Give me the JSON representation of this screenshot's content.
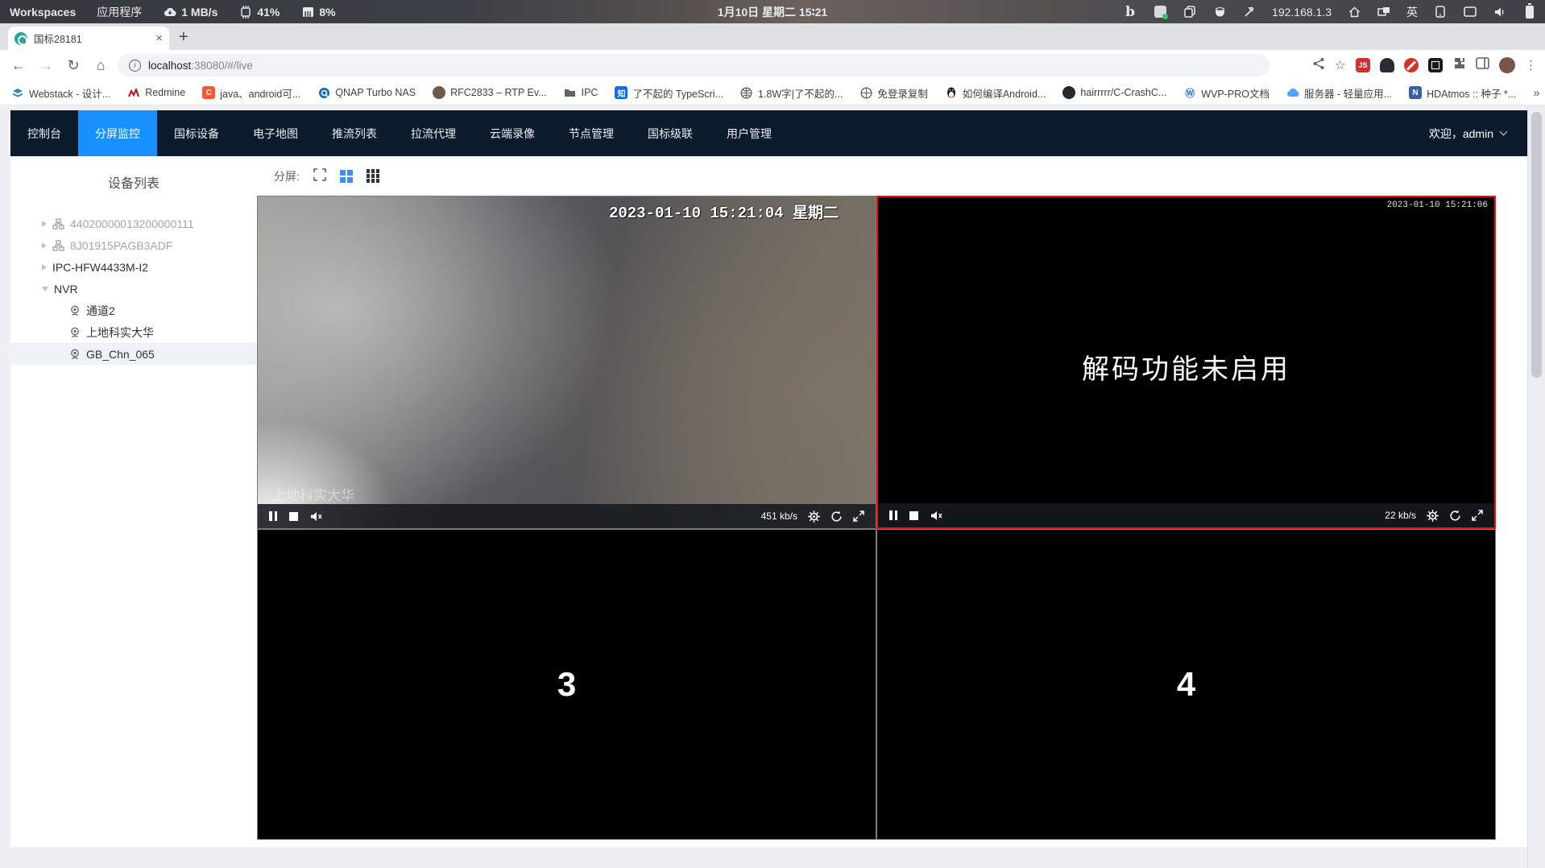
{
  "system_bar": {
    "workspaces": "Workspaces",
    "applications": "应用程序",
    "net_speed": "1 MB/s",
    "cpu": "41%",
    "mem": "8%",
    "clock": "1月10日 星期二 15∶21",
    "ip": "192.168.1.3",
    "lang": "英"
  },
  "browser": {
    "tab": {
      "title": "国标28181",
      "close": "×",
      "new_tab": "+"
    },
    "url": {
      "host": "localhost",
      "rest": ":38080/#/live"
    },
    "back": "←",
    "forward": "→",
    "reload": "↻",
    "home": "⌂",
    "star": "☆",
    "menu": "⋮",
    "bookmarks": [
      {
        "label": "Webstack - 设计..."
      },
      {
        "label": "Redmine"
      },
      {
        "label": "java、android可..."
      },
      {
        "label": "QNAP Turbo NAS"
      },
      {
        "label": "RFC2833 – RTP Ev..."
      },
      {
        "label": "IPC"
      },
      {
        "label": "了不起的 TypeScri..."
      },
      {
        "label": "1.8W字|了不起的..."
      },
      {
        "label": "免登录复制"
      },
      {
        "label": "如何编译Android..."
      },
      {
        "label": "hairrrrr/C-CrashC..."
      },
      {
        "label": "WVP-PRO文档"
      },
      {
        "label": "服务器 - 轻量应用..."
      },
      {
        "label": "HDAtmos :: 种子 *..."
      }
    ],
    "overflow": "»"
  },
  "nav": {
    "items": [
      {
        "label": "控制台"
      },
      {
        "label": "分屏监控"
      },
      {
        "label": "国标设备"
      },
      {
        "label": "电子地图"
      },
      {
        "label": "推流列表"
      },
      {
        "label": "拉流代理"
      },
      {
        "label": "云端录像"
      },
      {
        "label": "节点管理"
      },
      {
        "label": "国标级联"
      },
      {
        "label": "用户管理"
      }
    ],
    "active_item": "分屏监控",
    "welcome": "欢迎，admin"
  },
  "sidebar": {
    "title": "设备列表",
    "tree": [
      {
        "label": "44020000013200000111",
        "state": "offline-device"
      },
      {
        "label": "8J01915PAGB3ADF",
        "state": "offline-device"
      },
      {
        "label": "IPC-HFW4433M-I2",
        "state": "device"
      },
      {
        "label": "NVR",
        "state": "device-expanded"
      },
      {
        "label": "通道2",
        "state": "channel"
      },
      {
        "label": "上地科实大华",
        "state": "channel"
      },
      {
        "label": "GB_Chn_065",
        "state": "channel-selected"
      }
    ]
  },
  "screen_toolbar": {
    "label": "分屏:"
  },
  "players": {
    "p1": {
      "timestamp": "2023-01-10 15:21:04 星期二",
      "name": "上地科实大华",
      "bitrate": "451 kb/s"
    },
    "p2": {
      "timestamp": "2023-01-10 15:21:06",
      "message": "解码功能未启用",
      "bitrate": "22 kb/s",
      "selected": true
    },
    "p3": {
      "number": "3"
    },
    "p4": {
      "number": "4"
    }
  },
  "colors": {
    "accent_blue": "#1890ff",
    "nav_bg": "#0b1b2c",
    "selected_cell_border": "#ee1111",
    "tab_favicon": "#26a69a"
  }
}
